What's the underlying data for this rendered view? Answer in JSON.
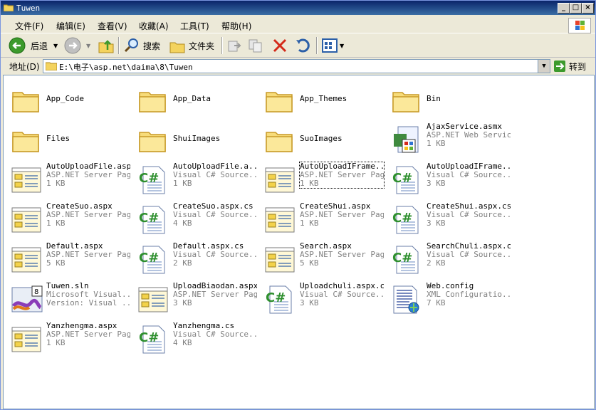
{
  "window": {
    "title": "Tuwen"
  },
  "menu": [
    "文件(F)",
    "编辑(E)",
    "查看(V)",
    "收藏(A)",
    "工具(T)",
    "帮助(H)"
  ],
  "toolbar": {
    "back": "后退",
    "search": "搜索",
    "folders": "文件夹"
  },
  "address": {
    "label": "地址(D)",
    "path": "E:\\电子\\asp.net\\daima\\8\\Tuwen",
    "go": "转到"
  },
  "files": [
    {
      "name": "App_Code",
      "kind": "folder"
    },
    {
      "name": "App_Data",
      "kind": "folder"
    },
    {
      "name": "App_Themes",
      "kind": "folder"
    },
    {
      "name": "Bin",
      "kind": "folder"
    },
    {
      "name": "Files",
      "kind": "folder"
    },
    {
      "name": "ShuiImages",
      "kind": "folder"
    },
    {
      "name": "SuoImages",
      "kind": "folder"
    },
    {
      "name": "AjaxService.asmx",
      "type": "ASP.NET Web Service",
      "size": "1 KB",
      "kind": "asmx"
    },
    {
      "name": "AutoUploadFile.aspx",
      "type": "ASP.NET Server Page",
      "size": "1 KB",
      "kind": "aspx"
    },
    {
      "name": "AutoUploadFile.a...",
      "type": "Visual C# Source...",
      "size": "1 KB",
      "kind": "cs"
    },
    {
      "name": "AutoUploadIFrame...",
      "type": "ASP.NET Server Page",
      "size": "1 KB",
      "kind": "aspx"
    },
    {
      "name": "AutoUploadIFrame...",
      "type": "Visual C# Source...",
      "size": "3 KB",
      "kind": "cs"
    },
    {
      "name": "CreateSuo.aspx",
      "type": "ASP.NET Server Page",
      "size": "1 KB",
      "kind": "aspx"
    },
    {
      "name": "CreateSuo.aspx.cs",
      "type": "Visual C# Source...",
      "size": "4 KB",
      "kind": "cs"
    },
    {
      "name": "CreateShui.aspx",
      "type": "ASP.NET Server Page",
      "size": "1 KB",
      "kind": "aspx"
    },
    {
      "name": "CreateShui.aspx.cs",
      "type": "Visual C# Source...",
      "size": "3 KB",
      "kind": "cs"
    },
    {
      "name": "Default.aspx",
      "type": "ASP.NET Server Page",
      "size": "5 KB",
      "kind": "aspx"
    },
    {
      "name": "Default.aspx.cs",
      "type": "Visual C# Source...",
      "size": "2 KB",
      "kind": "cs"
    },
    {
      "name": "Search.aspx",
      "type": "ASP.NET Server Page",
      "size": "5 KB",
      "kind": "aspx"
    },
    {
      "name": "SearchChuli.aspx.cs",
      "type": "Visual C# Source...",
      "size": "2 KB",
      "kind": "cs"
    },
    {
      "name": "Tuwen.sln",
      "type": "Microsoft Visual...",
      "size": "Version: Visual ...",
      "kind": "sln"
    },
    {
      "name": "UploadBiaodan.aspx",
      "type": "ASP.NET Server Page",
      "size": "3 KB",
      "kind": "aspx"
    },
    {
      "name": "Uploadchuli.aspx.cs",
      "type": "Visual C# Source...",
      "size": "3 KB",
      "kind": "cs"
    },
    {
      "name": "Web.config",
      "type": "XML Configuratio...",
      "size": "7 KB",
      "kind": "config"
    },
    {
      "name": "Yanzhengma.aspx",
      "type": "ASP.NET Server Page",
      "size": "1 KB",
      "kind": "aspx"
    },
    {
      "name": "Yanzhengma.cs",
      "type": "Visual C# Source...",
      "size": "4 KB",
      "kind": "cs"
    }
  ]
}
